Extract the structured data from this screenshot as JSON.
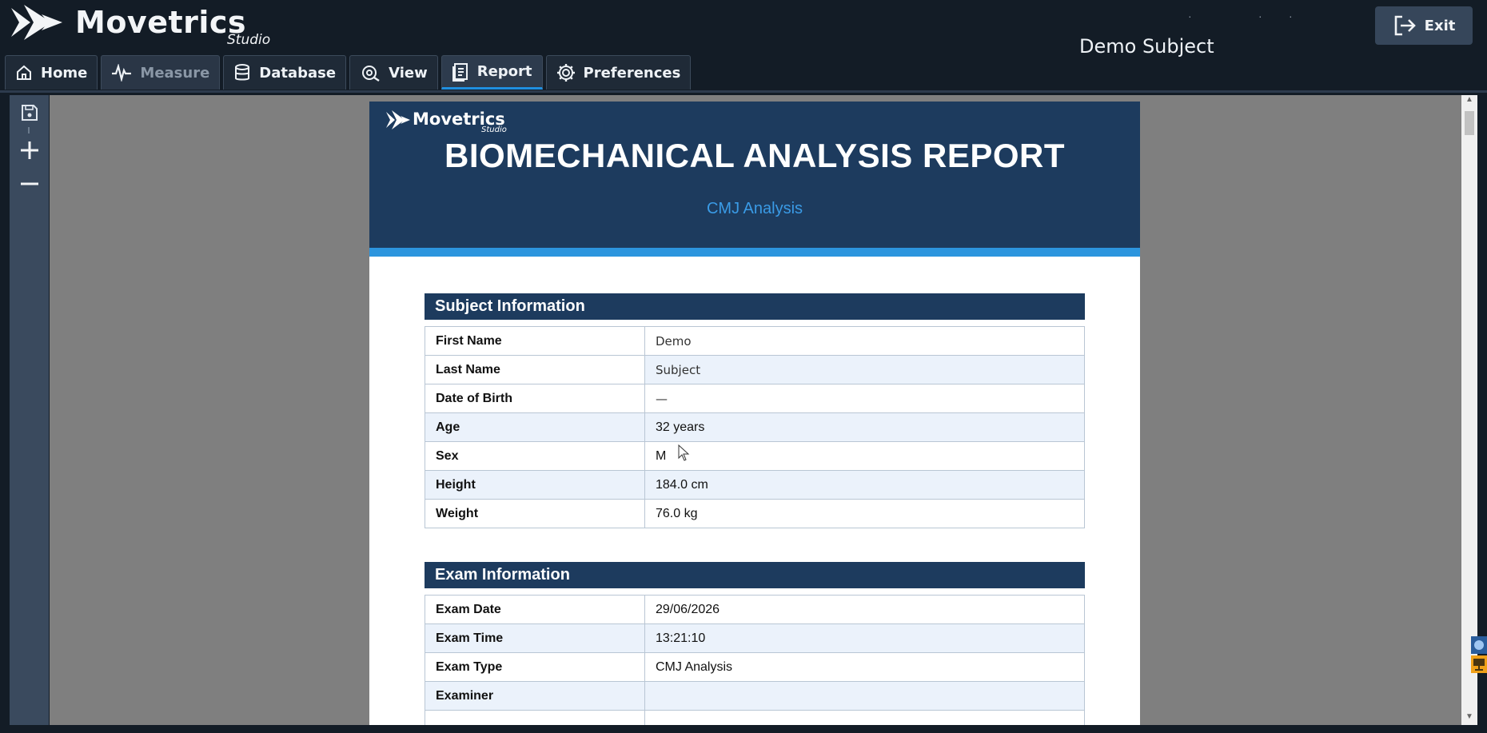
{
  "app": {
    "logo_text": "Movetrics",
    "logo_subtext": "Studio",
    "subject_name": "Demo Subject",
    "exit_label": "Exit"
  },
  "tabs": [
    {
      "label": "Home",
      "icon": "home-icon",
      "state": "normal"
    },
    {
      "label": "Measure",
      "icon": "waveform-icon",
      "state": "disabled"
    },
    {
      "label": "Database",
      "icon": "database-icon",
      "state": "normal"
    },
    {
      "label": "View",
      "icon": "eye-icon",
      "state": "normal"
    },
    {
      "label": "Report",
      "icon": "report-icon",
      "state": "active"
    },
    {
      "label": "Preferences",
      "icon": "gear-icon",
      "state": "normal"
    }
  ],
  "toolbar": {
    "tools": [
      "save-icon",
      "zoom-in-icon",
      "zoom-out-icon"
    ]
  },
  "report": {
    "logo_text": "Movetrics",
    "logo_subtext": "Studio",
    "title": "BIOMECHANICAL ANALYSIS REPORT",
    "subtitle": "CMJ Analysis",
    "subject_section": {
      "title": "Subject Information",
      "rows": [
        {
          "label": "First Name",
          "value": "Demo"
        },
        {
          "label": "Last Name",
          "value": "Subject"
        },
        {
          "label": "Date of Birth",
          "value": "—"
        },
        {
          "label": "Age",
          "value": "32 years"
        },
        {
          "label": "Sex",
          "value": "M"
        },
        {
          "label": "Height",
          "value": "184.0 cm"
        },
        {
          "label": "Weight",
          "value": "76.0 kg"
        }
      ]
    },
    "exam_section": {
      "title": "Exam Information",
      "rows": [
        {
          "label": "Exam Date",
          "value": "29/06/2026"
        },
        {
          "label": "Exam Time",
          "value": "13:21:10"
        },
        {
          "label": "Exam Type",
          "value": "CMJ Analysis"
        },
        {
          "label": "Examiner",
          "value": ""
        }
      ]
    }
  },
  "colors": {
    "app_background": "#131c26",
    "report_header": "#1d3b5e",
    "accent": "#2c95de",
    "active_tab_underline": "#1f8fe0"
  }
}
